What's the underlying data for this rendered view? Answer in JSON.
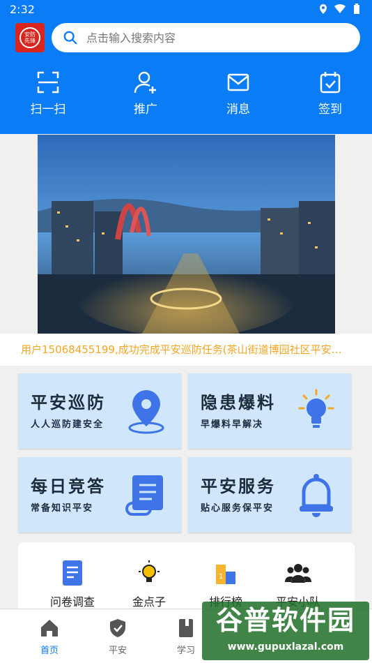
{
  "status_bar": {
    "time": "2:32"
  },
  "logo_text": "安防\n先锋",
  "search": {
    "placeholder": "点击输入搜索内容"
  },
  "quick_actions": [
    {
      "label": "扫一扫",
      "icon": "scan-icon"
    },
    {
      "label": "推广",
      "icon": "add-user-icon"
    },
    {
      "label": "消息",
      "icon": "mail-icon"
    },
    {
      "label": "签到",
      "icon": "calendar-check-icon"
    }
  ],
  "marquee_text": "用户15068455199,成功完成平安巡防任务(茶山街道博园社区平安…",
  "cards": [
    {
      "title": "平安巡防",
      "subtitle": "人人巡防建安全",
      "icon": "location-pin-icon"
    },
    {
      "title": "隐患爆料",
      "subtitle": "早爆料早解决",
      "icon": "lightbulb-icon"
    },
    {
      "title": "每日竞答",
      "subtitle": "常备知识平安",
      "icon": "scroll-icon"
    },
    {
      "title": "平安服务",
      "subtitle": "贴心服务保平安",
      "icon": "bell-icon"
    }
  ],
  "tools": [
    {
      "label": "问卷调查",
      "icon": "survey-icon"
    },
    {
      "label": "金点子",
      "icon": "idea-bulb-icon"
    },
    {
      "label": "排行榜",
      "icon": "ranking-icon"
    },
    {
      "label": "平安小队",
      "icon": "team-icon"
    }
  ],
  "tabs": [
    {
      "label": "首页",
      "icon": "home-icon",
      "active": true
    },
    {
      "label": "平安",
      "icon": "shield-icon",
      "active": false
    },
    {
      "label": "学习",
      "icon": "book-icon",
      "active": false
    }
  ],
  "watermark": {
    "title": "谷普软件园",
    "url": "www.gupuxlazal.com"
  },
  "colors": {
    "primary": "#0a7cf5",
    "card_bg": "#cfe6fb",
    "marquee": "#f5a623",
    "accent_blue": "#3f74e8"
  }
}
